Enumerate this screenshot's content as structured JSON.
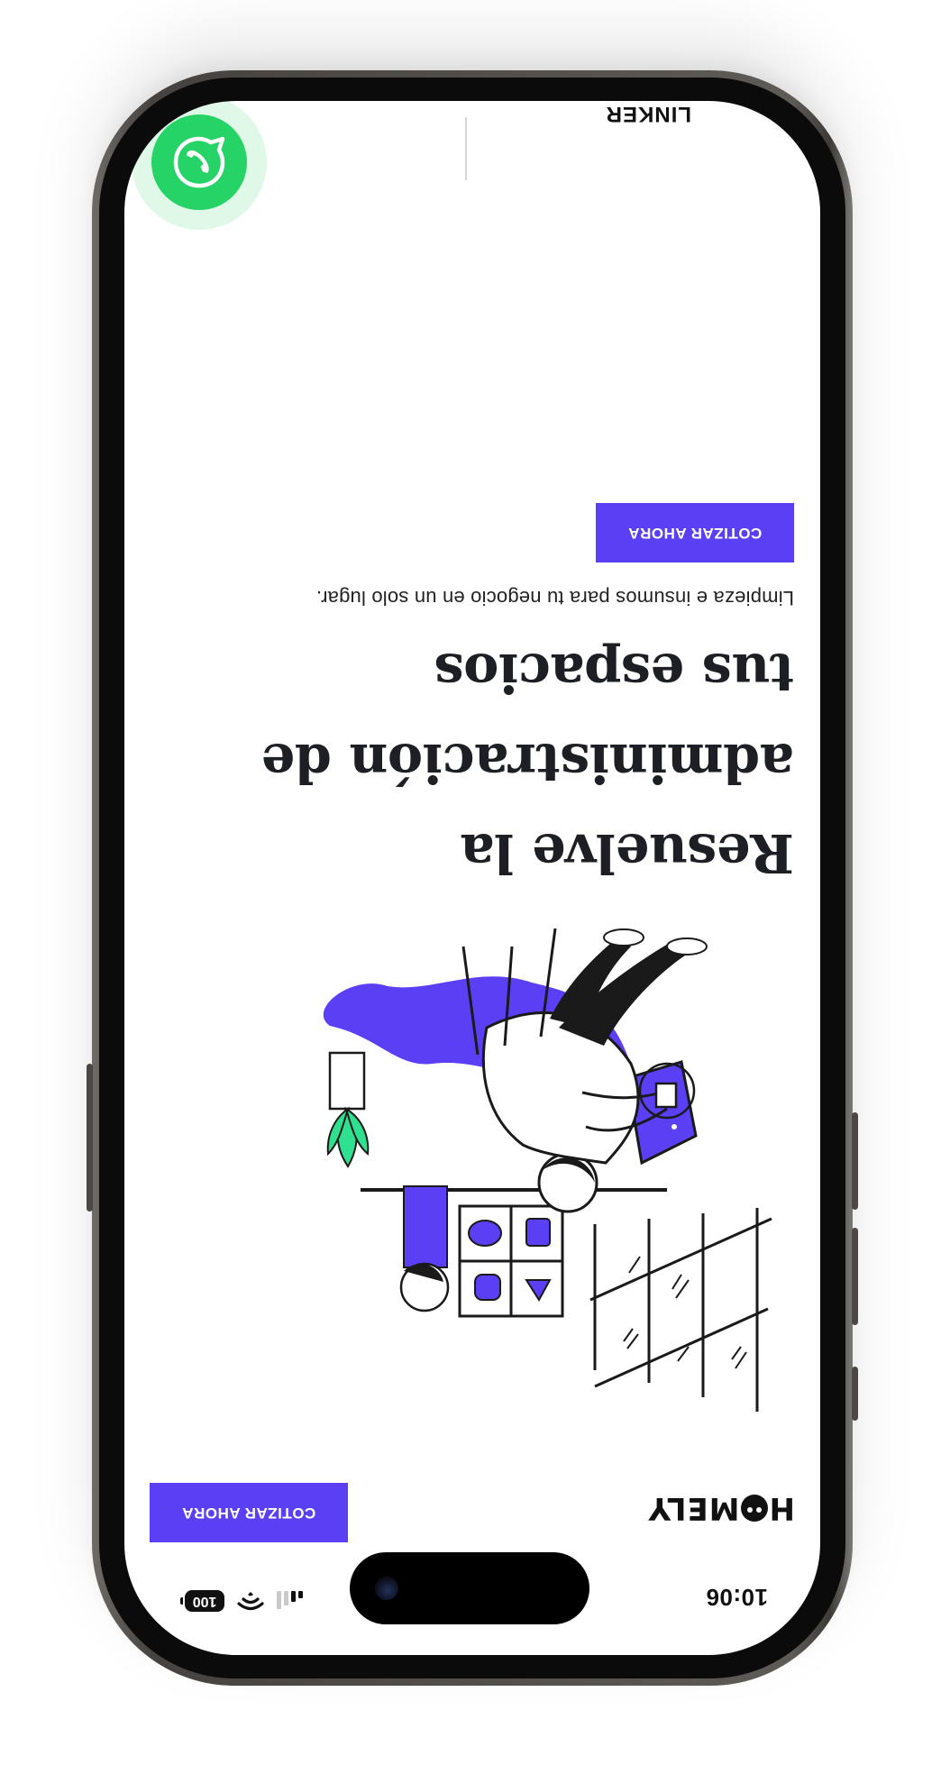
{
  "status_bar": {
    "time": "10:06",
    "battery": "100"
  },
  "header": {
    "logo_text": "H●MELY",
    "cta_label": "COTIZAR AHORA"
  },
  "hero": {
    "title_lines": [
      "Resuelve la",
      "administración de",
      "tus espacios"
    ],
    "subtitle": "Limpieza e insumos para tu negocio en un solo lugar.",
    "cta_label": "COTIZAR AHORA"
  },
  "footer_partial": {
    "brand_text": "LINKER"
  },
  "colors": {
    "accent": "#5b3ff4",
    "whatsapp": "#25d366",
    "plant": "#2ee08f",
    "text": "#1d1f24"
  },
  "icons": [
    "whatsapp-icon",
    "signal-icon",
    "wifi-icon",
    "battery-icon"
  ]
}
